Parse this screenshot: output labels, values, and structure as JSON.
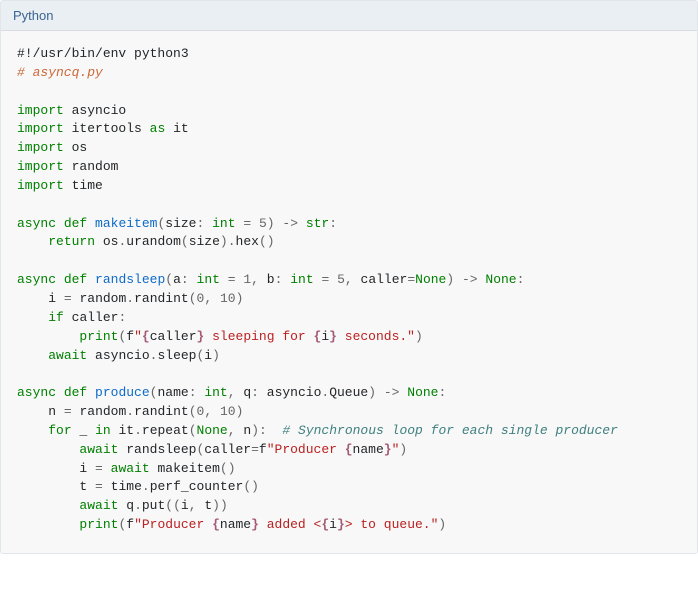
{
  "header": {
    "label": "Python"
  },
  "code": {
    "shebang": "#!/usr/bin/env python3",
    "file_comment": "# asyncq.py",
    "imp": {
      "kw_import": "import",
      "kw_as": "as",
      "m1": "asyncio",
      "m2": "itertools",
      "m2_alias": "it",
      "m3": "os",
      "m4": "random",
      "m5": "time"
    },
    "kw": {
      "async": "async",
      "def": "def",
      "return": "return",
      "if": "if",
      "await": "await",
      "for": "for",
      "in": "in"
    },
    "bi": {
      "int": "int",
      "str": "str",
      "None": "None",
      "print": "print"
    },
    "num": {
      "n0": "0",
      "n1": "1",
      "n5": "5",
      "n10": "10"
    },
    "op": {
      "lpar": "(",
      "rpar": ")",
      "colon": ":",
      "comma": ",",
      "eq": "=",
      "arrow": "->",
      "dot": ".",
      "under": "_"
    },
    "id": {
      "size": "size",
      "os": "os",
      "urandom": "urandom",
      "hex": "hex",
      "a": "a",
      "b": "b",
      "caller": "caller",
      "i": "i",
      "random": "random",
      "randint": "randint",
      "asyncio": "asyncio",
      "sleep": "sleep",
      "Queue": "Queue",
      "name": "name",
      "q": "q",
      "n": "n",
      "it": "it",
      "repeat": "repeat",
      "randsleep_call": "randsleep",
      "makeitem_call": "makeitem",
      "t": "t",
      "time": "time",
      "perf_counter": "perf_counter",
      "put": "put",
      "f": "f"
    },
    "fn": {
      "makeitem": "makeitem",
      "randsleep": "randsleep",
      "produce": "produce"
    },
    "str": {
      "s1a": "\"",
      "s1b": " sleeping for ",
      "s1c": " seconds.\"",
      "s2a": "\"Producer ",
      "s2b": "\"",
      "s3a": "\"Producer ",
      "s3b": " added <",
      "s3c": "> to queue.\""
    },
    "si": {
      "lb": "{",
      "rb": "}",
      "caller": "caller",
      "i": "i",
      "name": "name"
    },
    "cmt": {
      "loop": "# Synchronous loop for each single producer"
    }
  }
}
